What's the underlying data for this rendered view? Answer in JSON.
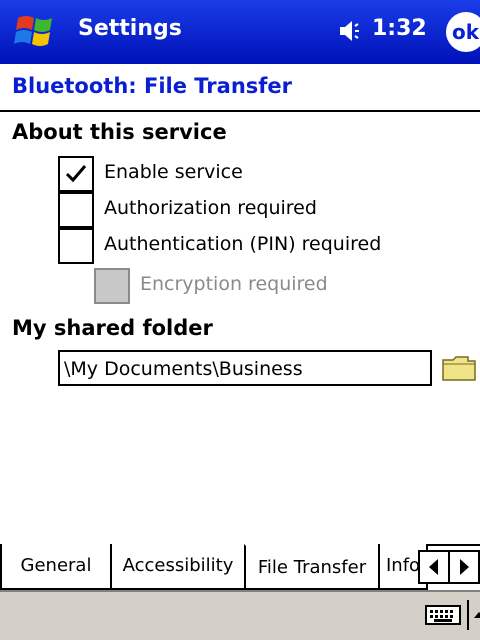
{
  "titlebar": {
    "app_title": "Settings",
    "time": "1:32",
    "ok_label": "ok"
  },
  "page": {
    "heading": "Bluetooth: File Transfer"
  },
  "about": {
    "title": "About this service",
    "options": [
      {
        "label": "Enable service",
        "checked": true,
        "enabled": true
      },
      {
        "label": "Authorization required",
        "checked": false,
        "enabled": true
      },
      {
        "label": "Authentication (PIN) required",
        "checked": false,
        "enabled": true
      },
      {
        "label": "Encryption required",
        "checked": false,
        "enabled": false
      }
    ]
  },
  "shared_folder": {
    "title": "My shared folder",
    "value": "\\My Documents\\Business"
  },
  "tabs": [
    {
      "label": "General",
      "active": false
    },
    {
      "label": "Accessibility",
      "active": false
    },
    {
      "label": "File Transfer",
      "active": true
    },
    {
      "label": "Info",
      "active": false
    }
  ],
  "colors": {
    "titlebar": "#0a1ed2",
    "heading": "#0a1ed2",
    "disabled": "#8a8a8a",
    "menubar": "#d4d0c8"
  },
  "icons": [
    "windows-flag-icon",
    "speaker-icon",
    "check-icon",
    "folder-icon",
    "arrow-left-icon",
    "arrow-right-icon",
    "keyboard-icon",
    "arrow-up-icon"
  ]
}
